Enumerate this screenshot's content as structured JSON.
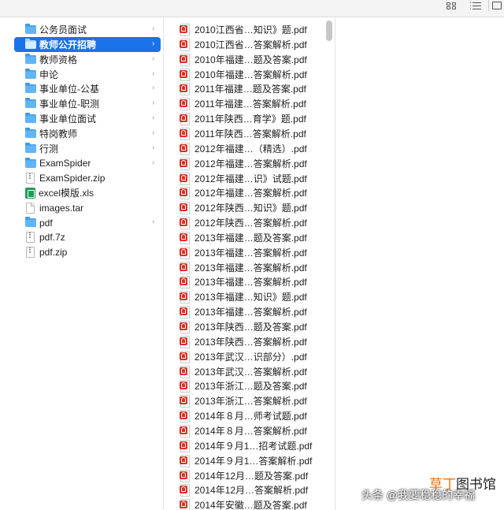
{
  "colors": {
    "selection": "#1a73e8",
    "folder": "#4aa6ef",
    "pdf": "#d93025",
    "xls": "#1f9d55"
  },
  "sidebar": {
    "items": [
      {
        "label": "公务员面试",
        "type": "folder",
        "selected": false
      },
      {
        "label": "教师公开招聘",
        "type": "folder",
        "selected": true
      },
      {
        "label": "教师资格",
        "type": "folder",
        "selected": false
      },
      {
        "label": "申论",
        "type": "folder",
        "selected": false
      },
      {
        "label": "事业单位-公基",
        "type": "folder",
        "selected": false
      },
      {
        "label": "事业单位-职测",
        "type": "folder",
        "selected": false
      },
      {
        "label": "事业单位面试",
        "type": "folder",
        "selected": false
      },
      {
        "label": "特岗教师",
        "type": "folder",
        "selected": false
      },
      {
        "label": "行测",
        "type": "folder",
        "selected": false
      },
      {
        "label": "ExamSpider",
        "type": "folder",
        "selected": false
      },
      {
        "label": "ExamSpider.zip",
        "type": "zip",
        "selected": false
      },
      {
        "label": "excel模版.xls",
        "type": "xls",
        "selected": false
      },
      {
        "label": "images.tar",
        "type": "doc",
        "selected": false
      },
      {
        "label": "pdf",
        "type": "folder",
        "selected": false
      },
      {
        "label": "pdf.7z",
        "type": "zip",
        "selected": false
      },
      {
        "label": "pdf.zip",
        "type": "zip",
        "selected": false
      }
    ]
  },
  "files": [
    "2010江西省…知识》题.pdf",
    "2010江西省…答案解析.pdf",
    "2010年福建…题及答案.pdf",
    "2010年福建…答案解析.pdf",
    "2011年福建…题及答案.pdf",
    "2011年福建…答案解析.pdf",
    "2011年陕西…育学》题.pdf",
    "2011年陕西…答案解析.pdf",
    "2012年福建…（精选）.pdf",
    "2012年福建…答案解析.pdf",
    "2012年福建…识》试题.pdf",
    "2012年福建…答案解析.pdf",
    "2012年陕西…知识》题.pdf",
    "2012年陕西…答案解析.pdf",
    "2013年福建…题及答案.pdf",
    "2013年福建…答案解析.pdf",
    "2013年福建…答案解析.pdf",
    "2013年福建…答案解析.pdf",
    "2013年福建…知识》题.pdf",
    "2013年福建…答案解析.pdf",
    "2013年陕西…题及答案.pdf",
    "2013年陕西…答案解析.pdf",
    "2013年武汉…识部分）.pdf",
    "2013年武汉…答案解析.pdf",
    "2013年浙江…题及答案.pdf",
    "2013年浙江…答案解析.pdf",
    "2014年８月…师考试题.pdf",
    "2014年８月…答案解析.pdf",
    "2014年９月1…招考试题.pdf",
    "2014年９月1…答案解析.pdf",
    "2014年12月…题及答案.pdf",
    "2014年12月…答案解析.pdf",
    "2014年安徽…题及答案.pdf"
  ],
  "watermark": {
    "site_accent": "草丁",
    "site_rest": "图书馆",
    "author": "头条 @我要稳稳的幸福"
  }
}
